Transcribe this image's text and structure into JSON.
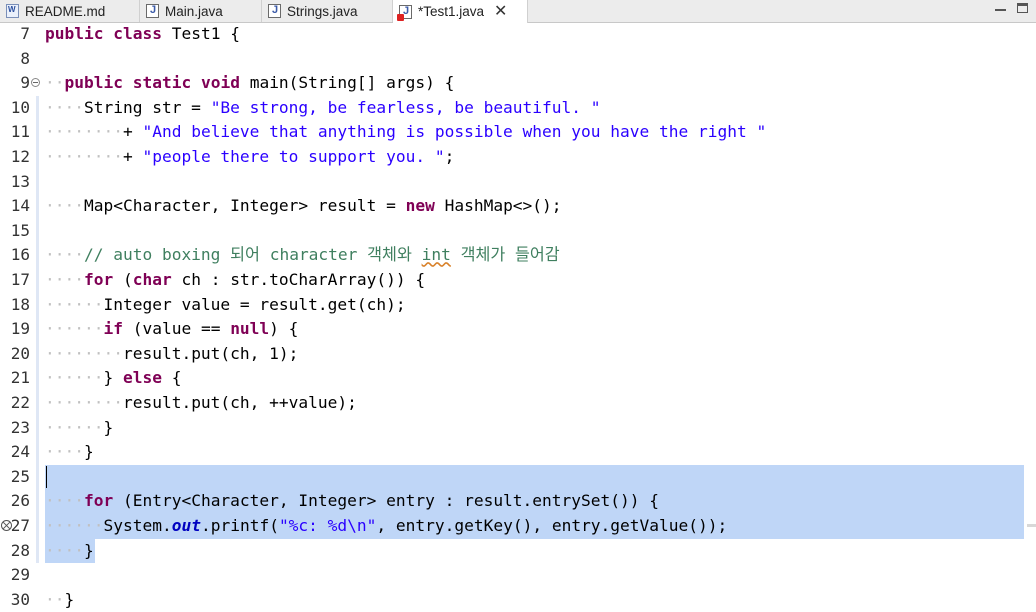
{
  "tabs": [
    {
      "label": "README.md",
      "icon": "markdown-file-icon"
    },
    {
      "label": "Main.java",
      "icon": "java-file-icon"
    },
    {
      "label": "Strings.java",
      "icon": "java-file-icon"
    },
    {
      "label": "*Test1.java",
      "icon": "java-file-error-icon",
      "active": true,
      "close_glyph": "✕"
    }
  ],
  "lines": [
    {
      "n": "7",
      "t": [
        [
          "kw",
          "public"
        ],
        [
          "",
          "·"
        ],
        [
          "kw",
          "class"
        ],
        [
          "",
          "·Test1·{"
        ]
      ]
    },
    {
      "n": "8",
      "t": []
    },
    {
      "n": "9",
      "t": [
        [
          "ws",
          "··"
        ],
        [
          "kw",
          "public"
        ],
        [
          "",
          "·"
        ],
        [
          "kw",
          "static"
        ],
        [
          "",
          "·"
        ],
        [
          "kw",
          "void"
        ],
        [
          "",
          "·main(String[]·args)·{"
        ]
      ]
    },
    {
      "n": "10",
      "t": [
        [
          "ws",
          "····"
        ],
        [
          "",
          "String·str·=·"
        ],
        [
          "str",
          "\"Be·strong,·be·fearless,·be·beautiful.·\""
        ]
      ]
    },
    {
      "n": "11",
      "t": [
        [
          "ws",
          "········"
        ],
        [
          "",
          "+·"
        ],
        [
          "str",
          "\"And·believe·that·anything·is·possible·when·you·have·the·right·\""
        ]
      ]
    },
    {
      "n": "12",
      "t": [
        [
          "ws",
          "········"
        ],
        [
          "",
          "+·"
        ],
        [
          "str",
          "\"people·there·to·support·you.·\""
        ],
        [
          "",
          ";"
        ]
      ]
    },
    {
      "n": "13",
      "t": []
    },
    {
      "n": "14",
      "t": [
        [
          "ws",
          "····"
        ],
        [
          "",
          "Map<Character,·Integer>·result·=·"
        ],
        [
          "kw",
          "new"
        ],
        [
          "",
          "·HashMap<>();"
        ]
      ]
    },
    {
      "n": "15",
      "t": []
    },
    {
      "n": "16",
      "t": [
        [
          "ws",
          "····"
        ],
        [
          "cmt",
          "//·auto·boxing·되어·character·객체와·"
        ],
        [
          "cmt und",
          "int"
        ],
        [
          "cmt",
          "·객체가·들어감"
        ]
      ]
    },
    {
      "n": "17",
      "t": [
        [
          "ws",
          "····"
        ],
        [
          "kw",
          "for"
        ],
        [
          "",
          "·("
        ],
        [
          "kw",
          "char"
        ],
        [
          "",
          "·ch·:·str.toCharArray())·{"
        ]
      ]
    },
    {
      "n": "18",
      "t": [
        [
          "ws",
          "······"
        ],
        [
          "",
          "Integer·value·=·result.get(ch);"
        ]
      ]
    },
    {
      "n": "19",
      "t": [
        [
          "ws",
          "······"
        ],
        [
          "kw",
          "if"
        ],
        [
          "",
          "·(value·==·"
        ],
        [
          "kw",
          "null"
        ],
        [
          "",
          ")·{"
        ]
      ]
    },
    {
      "n": "20",
      "t": [
        [
          "ws",
          "········"
        ],
        [
          "",
          "result.put(ch,·1);"
        ]
      ]
    },
    {
      "n": "21",
      "t": [
        [
          "ws",
          "······"
        ],
        [
          "",
          "}·"
        ],
        [
          "kw",
          "else"
        ],
        [
          "",
          "·{"
        ]
      ]
    },
    {
      "n": "22",
      "t": [
        [
          "ws",
          "········"
        ],
        [
          "",
          "result.put(ch,·++value);"
        ]
      ]
    },
    {
      "n": "23",
      "t": [
        [
          "ws",
          "······"
        ],
        [
          "",
          "}"
        ]
      ]
    },
    {
      "n": "24",
      "t": [
        [
          "ws",
          "····"
        ],
        [
          "",
          "}"
        ]
      ]
    },
    {
      "n": "25",
      "t": []
    },
    {
      "n": "26",
      "t": [
        [
          "ws",
          "····"
        ],
        [
          "kw",
          "for"
        ],
        [
          "",
          "·(Entry<Character,·Integer>·entry·:·result.entrySet())·{"
        ]
      ]
    },
    {
      "n": "27",
      "t": [
        [
          "ws",
          "······"
        ],
        [
          "",
          "System."
        ],
        [
          "fld",
          "out"
        ],
        [
          "",
          ".printf("
        ],
        [
          "str",
          "\"%c:·%d\\n\""
        ],
        [
          "",
          ",·entry.getKey(),·entry.getValue());"
        ]
      ]
    },
    {
      "n": "28",
      "t": [
        [
          "ws",
          "····"
        ],
        [
          "",
          "}"
        ]
      ]
    },
    {
      "n": "29",
      "t": []
    },
    {
      "n": "30",
      "t": [
        [
          "ws",
          "··"
        ],
        [
          "",
          "}"
        ]
      ]
    }
  ]
}
